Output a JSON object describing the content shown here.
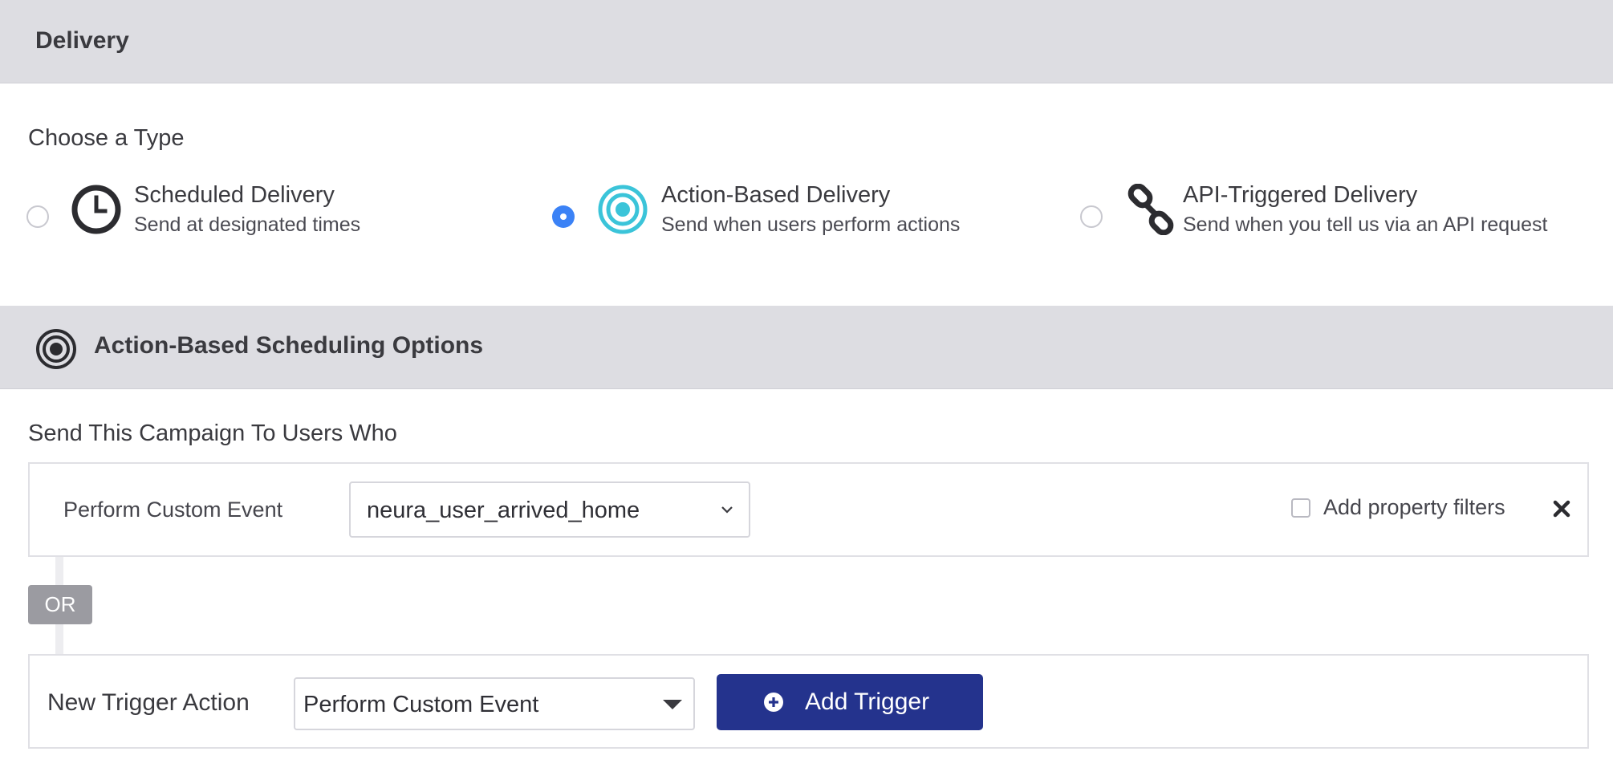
{
  "delivery": {
    "title": "Delivery",
    "choose_type_label": "Choose a Type",
    "types": [
      {
        "title": "Scheduled Delivery",
        "description": "Send at designated times",
        "icon": "clock-icon",
        "selected": false
      },
      {
        "title": "Action-Based Delivery",
        "description": "Send when users perform actions",
        "icon": "target-icon",
        "selected": true
      },
      {
        "title": "API-Triggered Delivery",
        "description": "Send when you tell us via an API request",
        "icon": "link-icon",
        "selected": false
      }
    ]
  },
  "options": {
    "title": "Action-Based Scheduling Options",
    "icon": "target-icon",
    "send_to_label": "Send This Campaign To Users Who",
    "trigger": {
      "event_label": "Perform Custom Event",
      "event_value": "neura_user_arrived_home",
      "property_filters_label": "Add property filters",
      "property_filters_checked": false,
      "remove_icon": "close-icon"
    },
    "or_label": "OR",
    "new_trigger": {
      "label": "New Trigger Action",
      "select_value": "Perform Custom Event",
      "add_button_label": "Add Trigger",
      "add_button_icon": "plus-circle-icon"
    }
  },
  "colors": {
    "header_bg": "#dddde2",
    "radio_selected": "#3b82f6",
    "target_icon_accent": "#3bc4d9",
    "button_bg": "#24338d",
    "or_badge_bg": "#9b9ba1"
  }
}
